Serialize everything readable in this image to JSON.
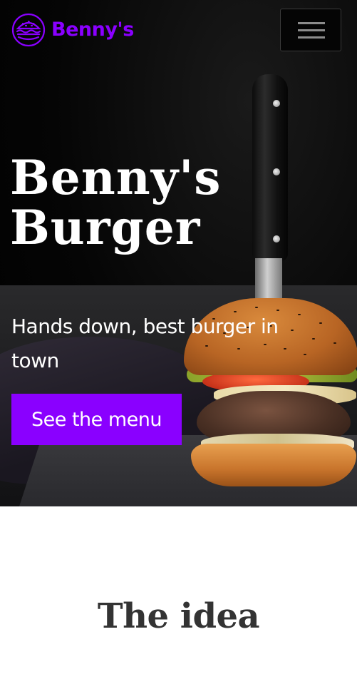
{
  "nav": {
    "brand": "Benny's",
    "logo_icon": "burger-icon",
    "menu_icon": "hamburger-menu-icon"
  },
  "hero": {
    "title_line1": "Benny's",
    "title_line2": "Burger",
    "tagline": "Hands down, best burger in town",
    "cta_label": "See the menu",
    "image": "burger-with-knife-photo"
  },
  "section": {
    "title": "The idea"
  },
  "colors": {
    "accent": "#8a00ff",
    "hero_bg": "#000000",
    "text_light": "#ffffff",
    "text_dark": "#333333"
  }
}
